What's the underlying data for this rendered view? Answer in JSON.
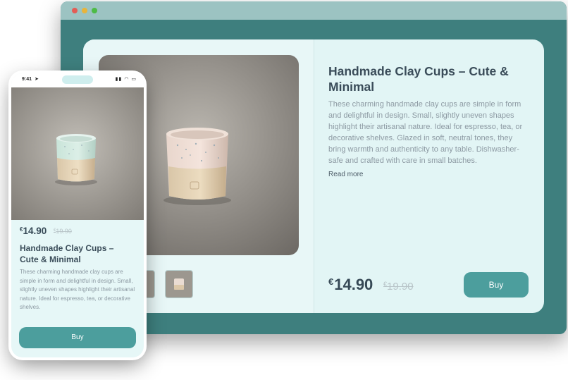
{
  "colors": {
    "window_bg": "#3e7f7e",
    "window_bar": "#9cc3c2",
    "card_bg": "#e2f5f5",
    "accent": "#4c9e9d",
    "title_text": "#3a4c59",
    "body_text": "#8d9aa3"
  },
  "product": {
    "title": "Handmade Clay Cups – Cute & Minimal",
    "description": "These charming handmade clay cups are simple in form and delightful in design. Small, slightly uneven shapes highlight their artisanal nature. Ideal for espresso, tea, or decorative shelves. Glazed in soft, neutral tones, they bring warmth and authenticity to any table. Dishwasher-safe and crafted with care in small batches.",
    "description_short": "These charming handmade clay cups are simple in form and delightful in design. Small, slightly uneven shapes highlight their artisanal nature. Ideal for espresso, tea, or decorative shelves.",
    "currency_symbol": "€",
    "price": "14.90",
    "old_price": "19.90",
    "read_more_label": "Read more",
    "buy_label": "Buy"
  },
  "phone_status": {
    "time": "9:41",
    "icons": [
      "location-arrow-icon",
      "signal-icon",
      "wifi-icon",
      "battery-icon"
    ]
  }
}
